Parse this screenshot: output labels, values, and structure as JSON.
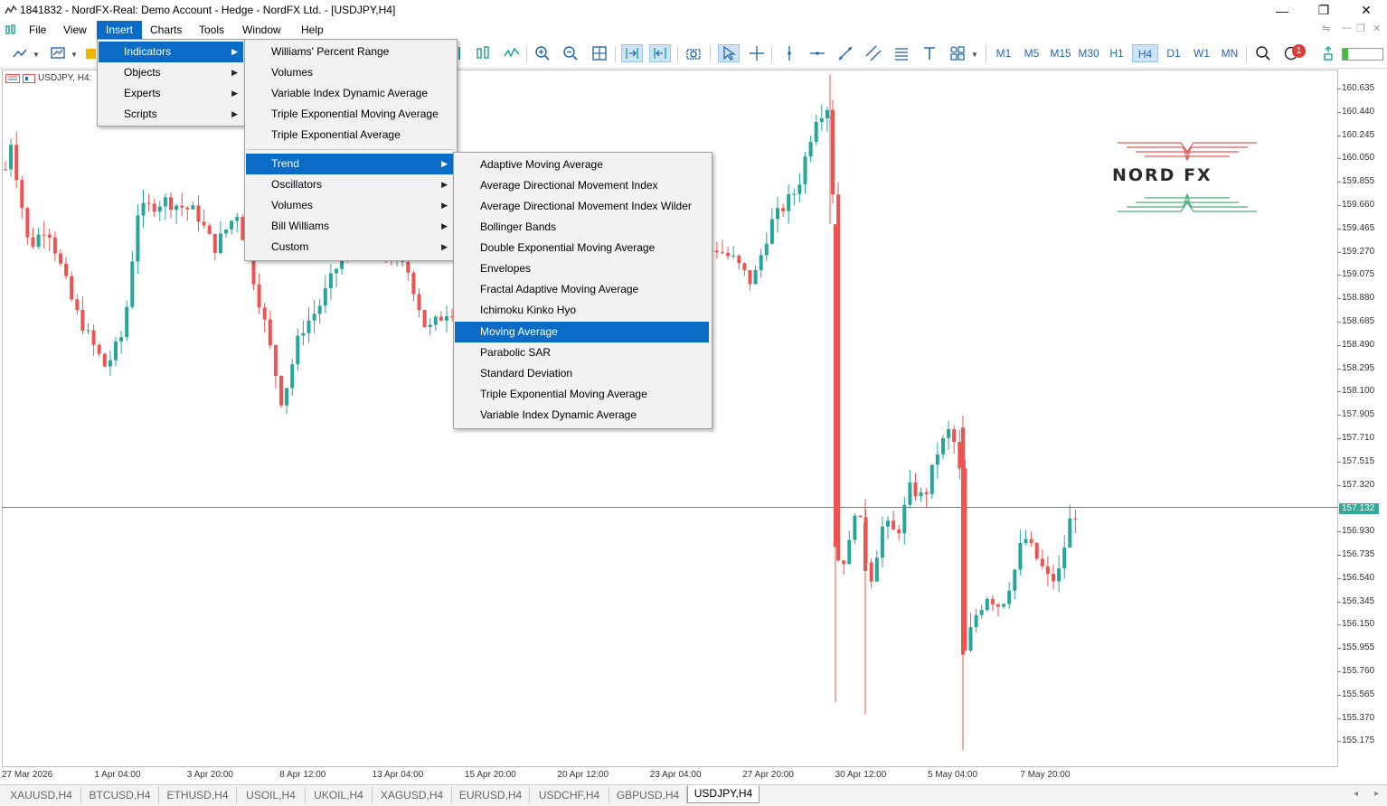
{
  "window": {
    "title": "1841832 - NordFX-Real: Demo Account - Hedge - NordFX Ltd. - [USDJPY,H4]",
    "minimize_glyph": "—",
    "restore_glyph": "❐",
    "close_glyph": "✕"
  },
  "menubar": {
    "items": [
      "File",
      "View",
      "Insert",
      "Charts",
      "Tools",
      "Window",
      "Help"
    ],
    "active": "Insert"
  },
  "toolbar": {
    "timeframes": [
      "M1",
      "M5",
      "M15",
      "M30",
      "H1",
      "H4",
      "D1",
      "W1",
      "MN"
    ],
    "active_timeframe": "H4",
    "notification_count": "1"
  },
  "insert_menu": {
    "items": [
      {
        "label": "Indicators",
        "submenu": true,
        "highlighted": true
      },
      {
        "label": "Objects",
        "submenu": true
      },
      {
        "label": "Experts",
        "submenu": true
      },
      {
        "label": "Scripts",
        "submenu": true
      }
    ]
  },
  "indicators_menu": {
    "recent": [
      "Williams' Percent Range",
      "Volumes",
      "Variable Index Dynamic Average",
      "Triple Exponential Moving Average",
      "Triple Exponential Average"
    ],
    "groups": [
      {
        "label": "Trend",
        "submenu": true,
        "highlighted": true
      },
      {
        "label": "Oscillators",
        "submenu": true
      },
      {
        "label": "Volumes",
        "submenu": true
      },
      {
        "label": "Bill Williams",
        "submenu": true
      },
      {
        "label": "Custom",
        "submenu": true
      }
    ]
  },
  "trend_menu": {
    "items": [
      "Adaptive Moving Average",
      "Average Directional Movement Index",
      "Average Directional Movement Index Wilder",
      "Bollinger Bands",
      "Double Exponential Moving Average",
      "Envelopes",
      "Fractal Adaptive Moving Average",
      "Ichimoku Kinko Hyo",
      "Moving Average",
      "Parabolic SAR",
      "Standard Deviation",
      "Triple Exponential Moving Average",
      "Variable Index Dynamic Average"
    ],
    "highlighted": "Moving Average"
  },
  "chart": {
    "symbol_label": "USDJPY, H4:",
    "logo_text": "NORD FX",
    "current_price": "157.132",
    "up_color": "#26a69a",
    "down_color": "#ef5350",
    "price_ticks": [
      "160.635",
      "160.440",
      "160.245",
      "160.050",
      "159.855",
      "159.660",
      "159.465",
      "159.270",
      "159.075",
      "158.880",
      "158.685",
      "158.490",
      "158.295",
      "158.100",
      "157.905",
      "157.710",
      "157.515",
      "157.320",
      "156.930",
      "156.735",
      "156.540",
      "156.345",
      "156.150",
      "155.955",
      "155.760",
      "155.565",
      "155.370",
      "155.175"
    ],
    "time_ticks": [
      "27 Mar 2026",
      "1 Apr 04:00",
      "3 Apr 20:00",
      "8 Apr 12:00",
      "13 Apr 04:00",
      "15 Apr 20:00",
      "20 Apr 12:00",
      "23 Apr 04:00",
      "27 Apr 20:00",
      "30 Apr 12:00",
      "5 May 04:00",
      "7 May 20:00"
    ]
  },
  "tabs": {
    "items": [
      "XAUUSD,H4",
      "BTCUSD,H4",
      "ETHUSD,H4",
      "USOIL,H4",
      "UKOIL,H4",
      "XAGUSD,H4",
      "EURUSD,H4",
      "USDCHF,H4",
      "GBPUSD,H4",
      "USDJPY,H4"
    ],
    "active": "USDJPY,H4"
  }
}
